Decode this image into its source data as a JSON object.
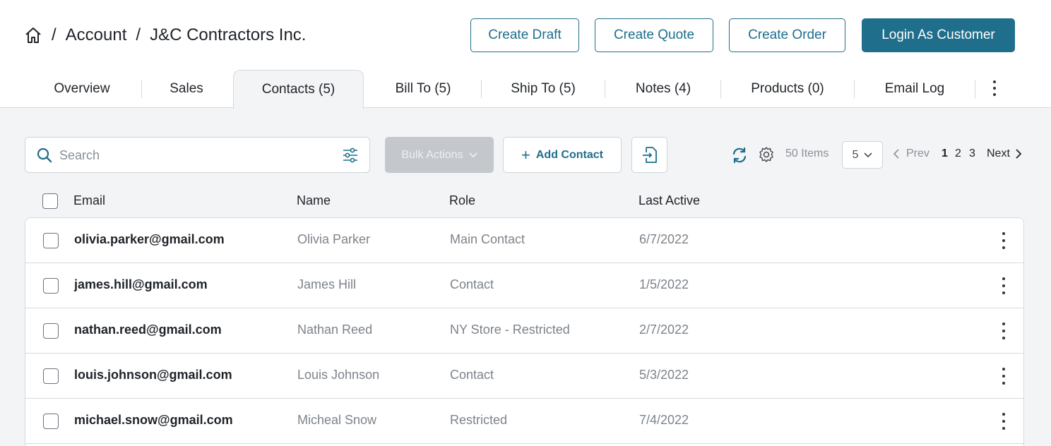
{
  "breadcrumb": {
    "sep": "/",
    "account": "Account",
    "company": "J&C Contractors Inc."
  },
  "actions": {
    "create_draft": "Create Draft",
    "create_quote": "Create Quote",
    "create_order": "Create Order",
    "login_as_customer": "Login As Customer"
  },
  "tabs": [
    {
      "label": "Overview"
    },
    {
      "label": "Sales"
    },
    {
      "label": "Contacts (5)"
    },
    {
      "label": "Bill To (5)"
    },
    {
      "label": "Ship To (5)"
    },
    {
      "label": "Notes (4)"
    },
    {
      "label": "Products (0)"
    },
    {
      "label": "Email Log"
    }
  ],
  "toolbar": {
    "search_placeholder": "Search",
    "bulk_actions": "Bulk Actions",
    "add_contact": "Add Contact",
    "items_count": "50 Items",
    "per_page": "5",
    "prev": "Prev",
    "pages": [
      "1",
      "2",
      "3"
    ],
    "next": "Next"
  },
  "table": {
    "columns": [
      "Email",
      "Name",
      "Role",
      "Last Active"
    ],
    "rows": [
      {
        "email": "olivia.parker@gmail.com",
        "name": "Olivia Parker",
        "role": "Main Contact",
        "last_active": "6/7/2022"
      },
      {
        "email": "james.hill@gmail.com",
        "name": "James Hill",
        "role": "Contact",
        "last_active": "1/5/2022"
      },
      {
        "email": "nathan.reed@gmail.com",
        "name": "Nathan Reed",
        "role": "NY Store - Restricted",
        "last_active": "2/7/2022"
      },
      {
        "email": "louis.johnson@gmail.com",
        "name": "Louis Johnson",
        "role": "Contact",
        "last_active": "5/3/2022"
      },
      {
        "email": "michael.snow@gmail.com",
        "name": "Micheal Snow",
        "role": "Restricted",
        "last_active": "7/4/2022"
      }
    ]
  },
  "colors": {
    "primary": "#1f6e8c",
    "border": "#d6d9de",
    "background": "#f3f4f6",
    "muted": "#7d838a"
  },
  "icons": [
    "home-icon",
    "search-icon",
    "filter-icon",
    "chevron-down-icon",
    "plus-icon",
    "export-icon",
    "refresh-icon",
    "gear-icon",
    "chevron-left-icon",
    "chevron-right-icon",
    "kebab-icon"
  ]
}
